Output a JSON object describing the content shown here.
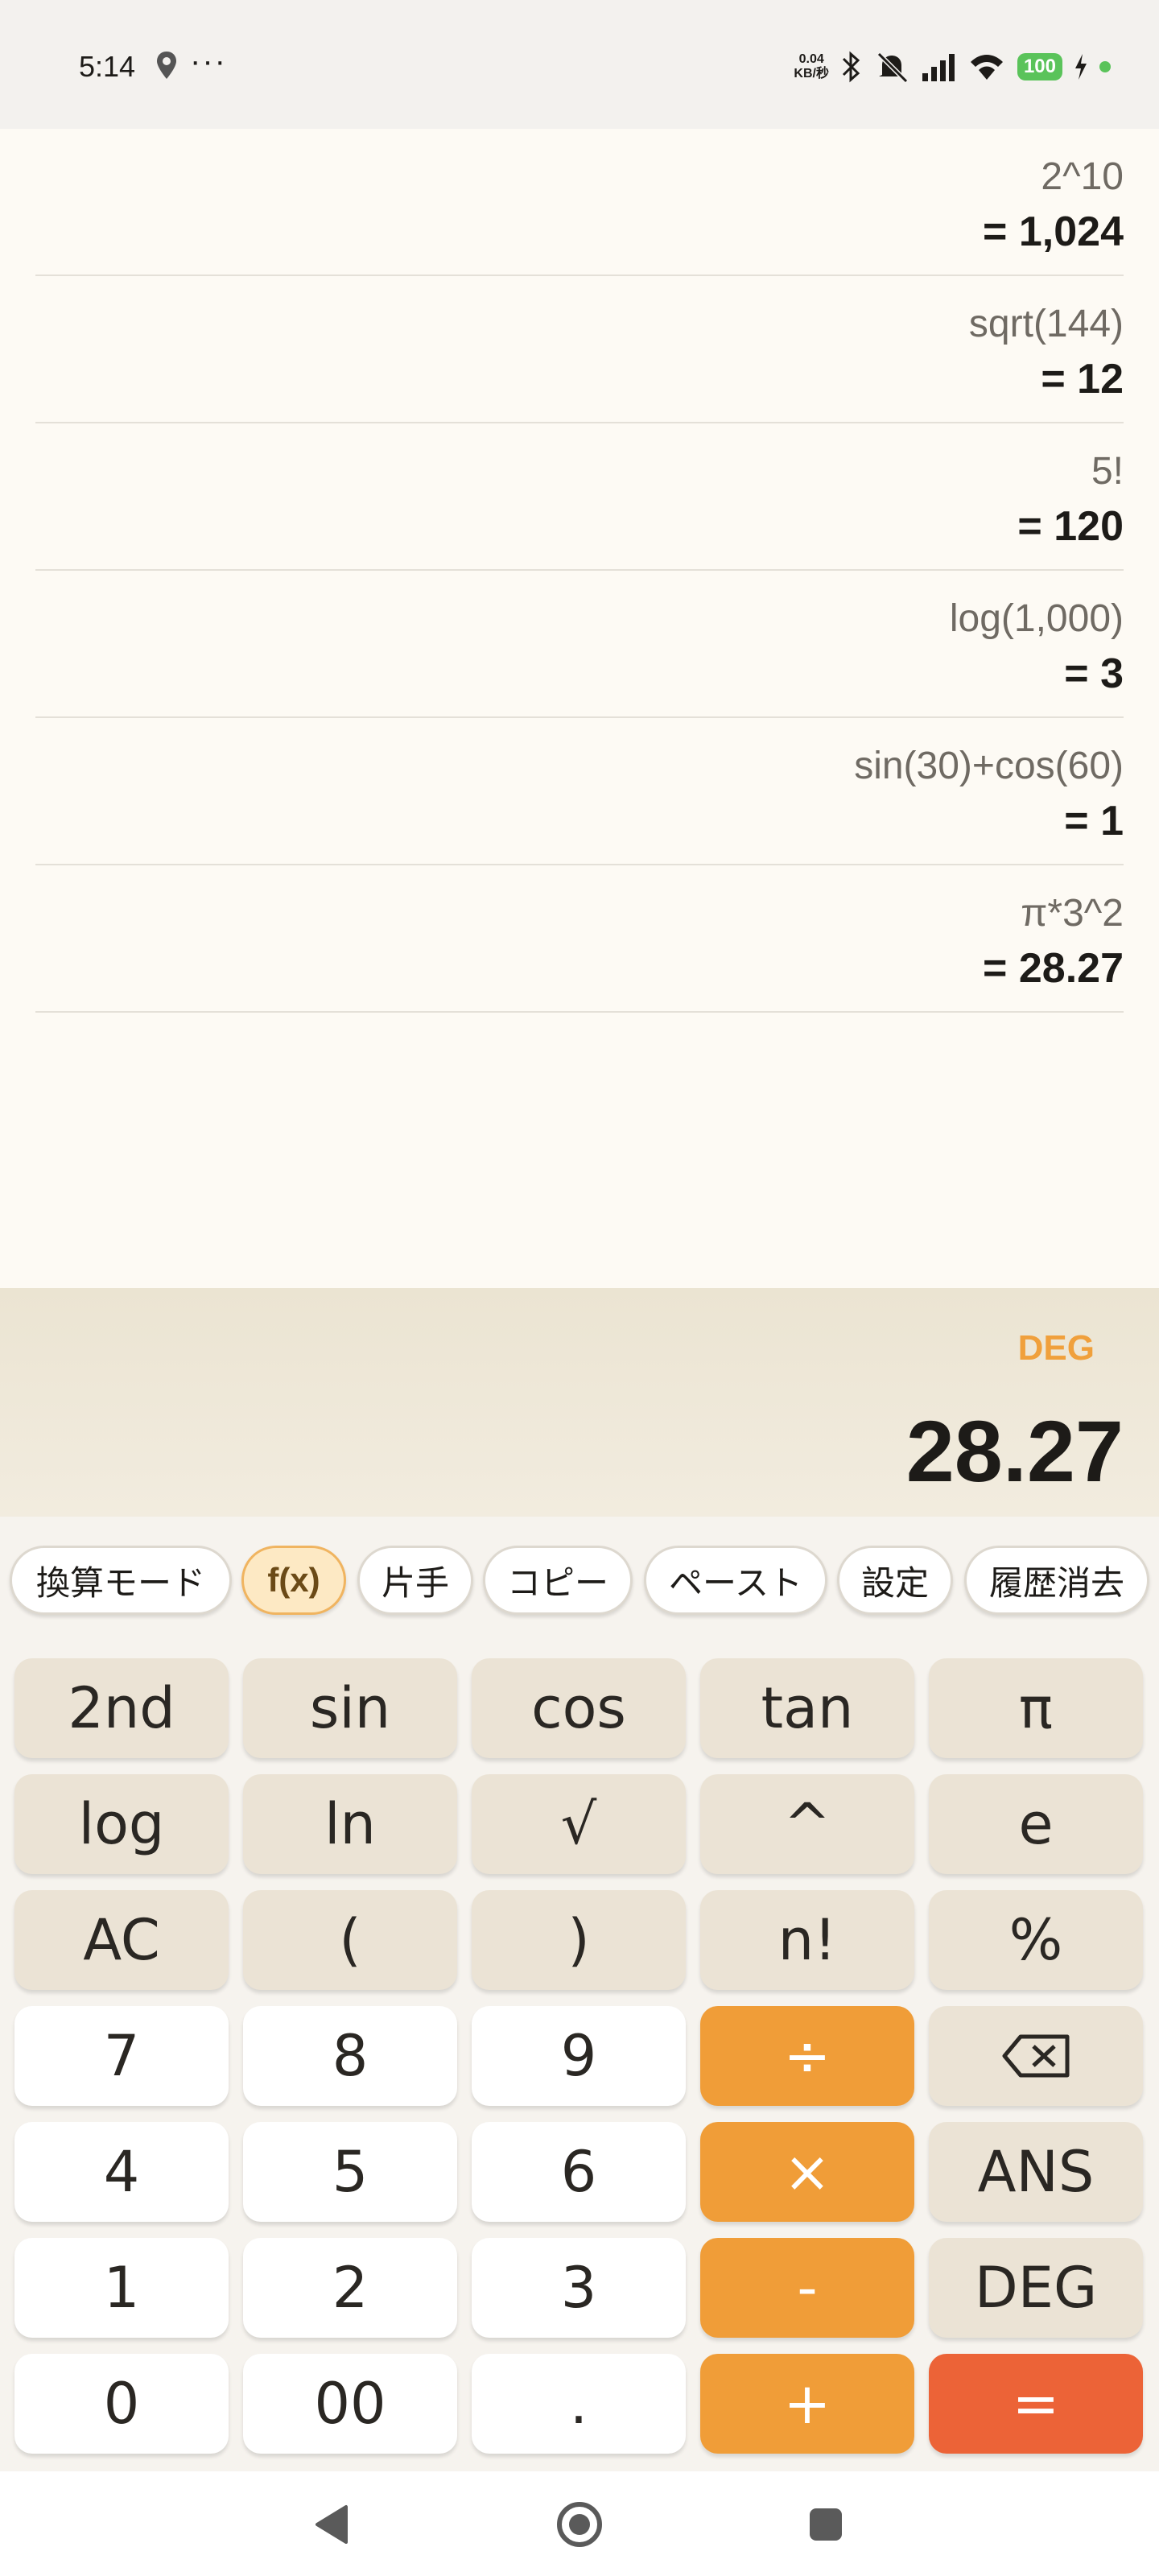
{
  "status_bar": {
    "time": "5:14",
    "net_speed_value": "0.04",
    "net_speed_unit": "KB/秒",
    "battery": "100"
  },
  "history": [
    {
      "expression": "2^10",
      "result": "= 1,024"
    },
    {
      "expression": "sqrt(144)",
      "result": "= 12"
    },
    {
      "expression": "5!",
      "result": "= 120"
    },
    {
      "expression": "log(1,000)",
      "result": "= 3"
    },
    {
      "expression": "sin(30)+cos(60)",
      "result": "= 1"
    },
    {
      "expression": "π*3^2",
      "result": "= 28.27"
    }
  ],
  "display": {
    "angle_mode": "DEG",
    "result": "28.27"
  },
  "toolbar": {
    "conversion_mode": "換算モード",
    "fx": "f(x)",
    "one_hand": "片手",
    "copy": "コピー",
    "paste": "ペースト",
    "settings": "設定",
    "clear_history": "履歴消去"
  },
  "keys": {
    "second": "2nd",
    "sin": "sin",
    "cos": "cos",
    "tan": "tan",
    "pi": "π",
    "log": "log",
    "ln": "ln",
    "sqrt": "√",
    "power": "^",
    "e": "e",
    "ac": "AC",
    "lparen": "(",
    "rparen": ")",
    "factorial": "n!",
    "percent": "%",
    "seven": "7",
    "eight": "8",
    "nine": "9",
    "divide": "÷",
    "four": "4",
    "five": "5",
    "six": "6",
    "multiply": "×",
    "ans": "ANS",
    "one": "1",
    "two": "2",
    "three": "3",
    "minus": "-",
    "deg": "DEG",
    "zero": "0",
    "double_zero": "00",
    "decimal": ".",
    "plus": "+",
    "equals": "="
  },
  "colors": {
    "accent_orange": "#f09d38",
    "equals_red": "#ec6337",
    "battery_green": "#5ac35a"
  }
}
